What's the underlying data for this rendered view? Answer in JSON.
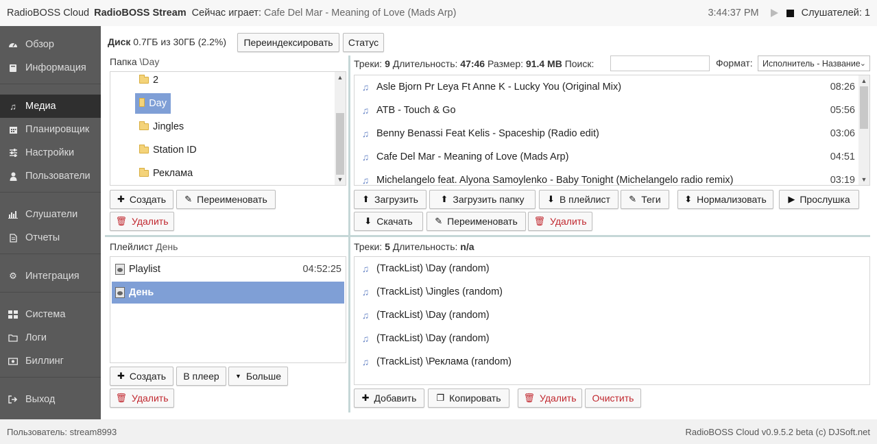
{
  "topbar": {
    "brand": "RadioBOSS Cloud",
    "stream": "RadioBOSS Stream",
    "now_playing_label": "Сейчас играет:",
    "now_playing_value": "Cafe Del Mar - Meaning of Love (Mads Arp)",
    "time": "3:44:37 PM",
    "listeners": "Слушателей: 1"
  },
  "sidebar": {
    "items": [
      {
        "label": "Обзор",
        "icon": "dashboard-icon"
      },
      {
        "label": "Информация",
        "icon": "book-icon"
      },
      {
        "label": "Медиа",
        "icon": "music-icon",
        "active": true
      },
      {
        "label": "Планировщик",
        "icon": "calendar-icon"
      },
      {
        "label": "Настройки",
        "icon": "sliders-icon"
      },
      {
        "label": "Пользователи",
        "icon": "user-icon"
      },
      {
        "label": "Слушатели",
        "icon": "bar-chart-icon"
      },
      {
        "label": "Отчеты",
        "icon": "document-icon"
      },
      {
        "label": "Интеграция",
        "icon": "gears-icon"
      },
      {
        "label": "Система",
        "icon": "grid-icon"
      },
      {
        "label": "Логи",
        "icon": "folder-icon"
      },
      {
        "label": "Биллинг",
        "icon": "money-icon"
      },
      {
        "label": "Выход",
        "icon": "logout-icon"
      }
    ]
  },
  "disk": {
    "label": "Диск",
    "value": "0.7ГБ из 30ГБ (2.2%)",
    "reindex": "Переиндексировать",
    "status": "Статус"
  },
  "folders": {
    "label": "Папка",
    "path": "\\Day",
    "items": [
      "2",
      "Day",
      "Jingles",
      "Station ID",
      "Реклама"
    ],
    "selected": "Day",
    "create": "Создать",
    "rename": "Переименовать",
    "delete": "Удалить"
  },
  "tracks": {
    "count_label": "Треки:",
    "count": "9",
    "duration_label": "Длительность:",
    "duration": "47:46",
    "size_label": "Размер:",
    "size": "91.4 MB",
    "search_label": "Поиск:",
    "format_label": "Формат:",
    "format_value": "Исполнитель - Название",
    "items": [
      {
        "title": "Asle Bjorn Pr Leya Ft Anne K - Lucky You (Original Mix)",
        "duration": "08:26"
      },
      {
        "title": "ATB - Touch & Go",
        "duration": "05:56"
      },
      {
        "title": "Benny Benassi Feat Kelis - Spaceship (Radio edit)",
        "duration": "03:06"
      },
      {
        "title": "Cafe Del Mar - Meaning of Love (Mads Arp)",
        "duration": "04:51"
      },
      {
        "title": "Michelangelo feat. Alyona Samoylenko - Baby Tonight (Michelangelo radio remix)",
        "duration": "03:19"
      }
    ],
    "upload": "Загрузить",
    "upload_folder": "Загрузить папку",
    "to_playlist": "В плейлист",
    "tags": "Теги",
    "normalize": "Нормализовать",
    "preview": "Прослушка",
    "download": "Скачать",
    "rename": "Переименовать",
    "delete": "Удалить"
  },
  "playlists": {
    "label": "Плейлист",
    "current": "День",
    "items": [
      {
        "name": "Playlist",
        "duration": "04:52:25"
      },
      {
        "name": "День",
        "duration": ""
      }
    ],
    "create": "Создать",
    "to_player": "В плеер",
    "more": "Больше",
    "delete": "Удалить"
  },
  "playlist_tracks": {
    "count_label": "Треки:",
    "count": "5",
    "duration_label": "Длительность:",
    "duration": "n/a",
    "items": [
      "(TrackList) \\Day (random)",
      "(TrackList) \\Jingles (random)",
      "(TrackList) \\Day (random)",
      "(TrackList) \\Day (random)",
      "(TrackList) \\Реклама (random)"
    ],
    "add": "Добавить",
    "copy": "Копировать",
    "delete": "Удалить",
    "clear": "Очистить"
  },
  "footer": {
    "user": "Пользователь: stream8993",
    "version": "RadioBOSS Cloud v0.9.5.2 beta (c) DJSoft.net"
  },
  "colors": {
    "selection": "#7f9fd6",
    "sidebar": "#5a5a5a",
    "sidebar_active": "#2f2f2f",
    "danger": "#c0262d"
  }
}
